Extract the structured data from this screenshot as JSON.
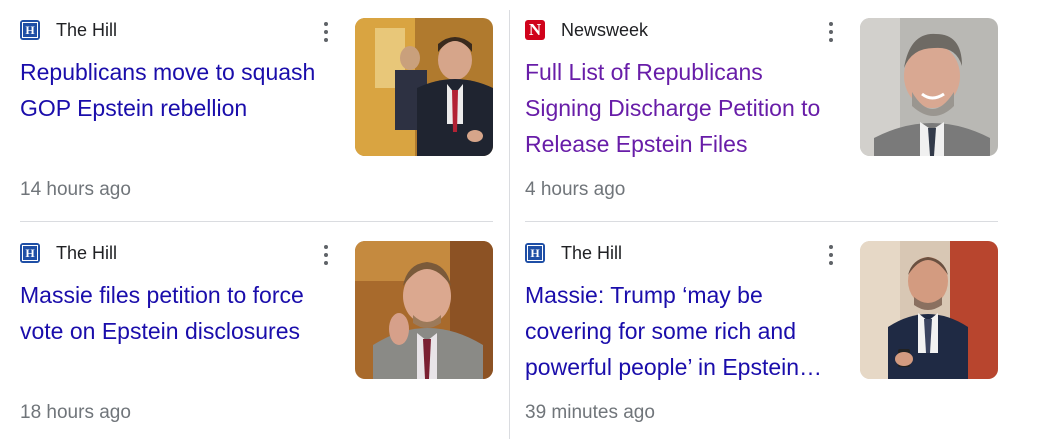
{
  "columns": [
    {
      "cards": [
        {
          "source": {
            "name": "The Hill",
            "logo_icon": "the-hill-logo-icon",
            "logo_letter": "H"
          },
          "headline": "Republicans move to squash GOP Epstein rebellion",
          "time": "14 hours ago",
          "thumbnail_subject": "man in dark suit with red tie walking in hallway"
        },
        {
          "source": {
            "name": "The Hill",
            "logo_icon": "the-hill-logo-icon",
            "logo_letter": "H"
          },
          "headline": "Massie files petition to force vote on Epstein disclosures",
          "time": "18 hours ago",
          "thumbnail_subject": "man in grey suit resting chin on hand"
        }
      ]
    },
    {
      "cards": [
        {
          "source": {
            "name": "Newsweek",
            "logo_icon": "newsweek-logo-icon",
            "logo_letter": "N"
          },
          "headline": "Full List of Republicans Signing Discharge Petition to Release Epstein Files",
          "time": "4 hours ago",
          "visited": true,
          "thumbnail_subject": "smiling bearded man in grey suit"
        },
        {
          "source": {
            "name": "The Hill",
            "logo_icon": "the-hill-logo-icon",
            "logo_letter": "H"
          },
          "headline": "Massie: Trump ‘may be covering for some rich and powerful people’ in Epstein…",
          "time": "39 minutes ago",
          "thumbnail_subject": "man in navy suit speaking with phone"
        }
      ]
    }
  ],
  "colors": {
    "link": "#1a0dab",
    "visited_link": "#681da8",
    "meta_text": "#70757a",
    "divider": "#dadce0",
    "hill_logo": "#1f4fa6",
    "newsweek_logo": "#d0021b"
  },
  "icons": {
    "more_options": "more-vert-icon"
  }
}
